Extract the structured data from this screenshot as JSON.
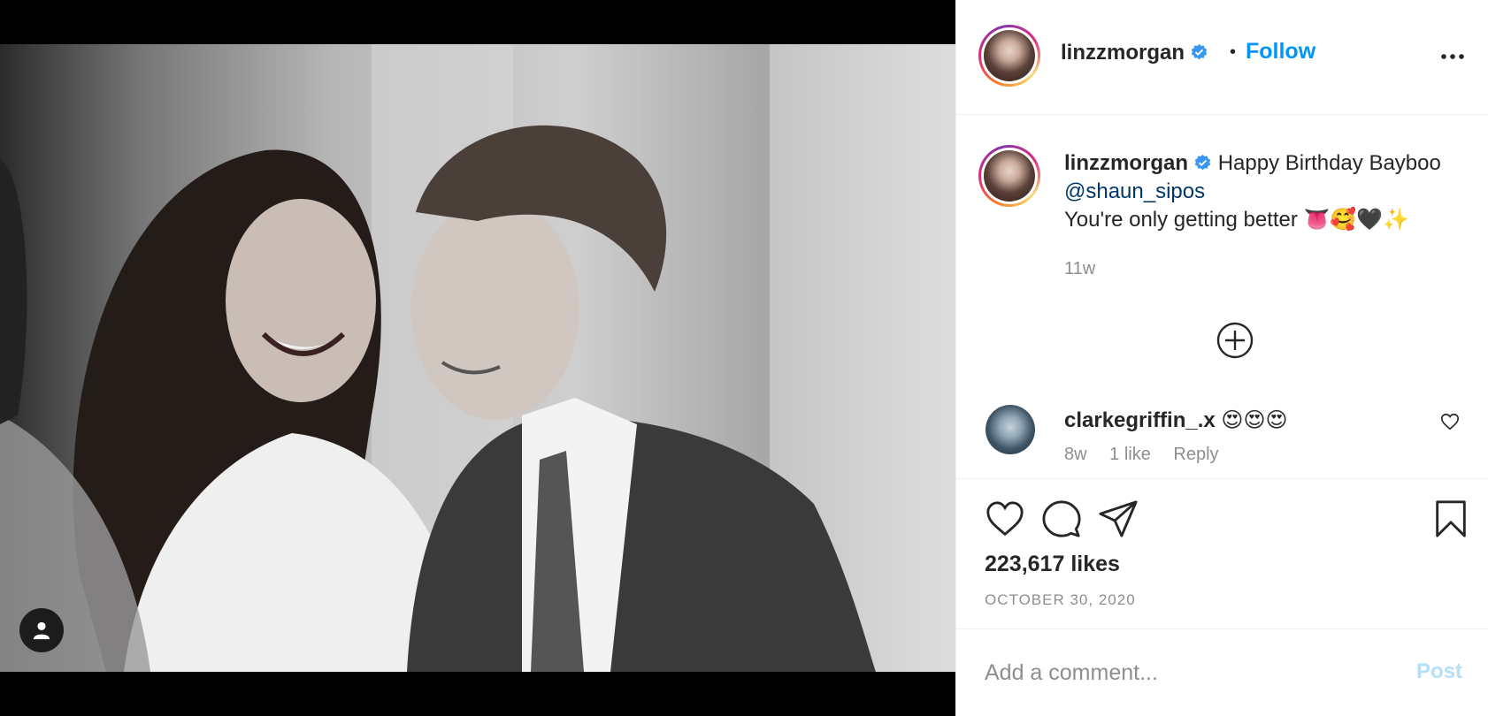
{
  "post": {
    "username": "linzzmorgan",
    "separator": "•",
    "follow_label": "Follow"
  },
  "caption": {
    "username": "linzzmorgan",
    "text_before": "Happy Birthday Bayboo",
    "mention": "@shaun_sipos",
    "text_line2": "You're only getting better 👅🥰🖤✨",
    "time": "11w"
  },
  "comments": [
    {
      "username": "clarkegriffin_.x",
      "text": "😍😍😍",
      "time": "8w",
      "likes": "1 like",
      "reply": "Reply"
    }
  ],
  "stats": {
    "likes": "223,617 likes",
    "date": "OCTOBER 30, 2020"
  },
  "add_comment": {
    "placeholder": "Add a comment...",
    "post_label": "Post"
  },
  "colors": {
    "accent": "#0095f6",
    "post_disabled": "#b2dffc",
    "mention": "#00376b",
    "muted": "#8e8e8e"
  }
}
